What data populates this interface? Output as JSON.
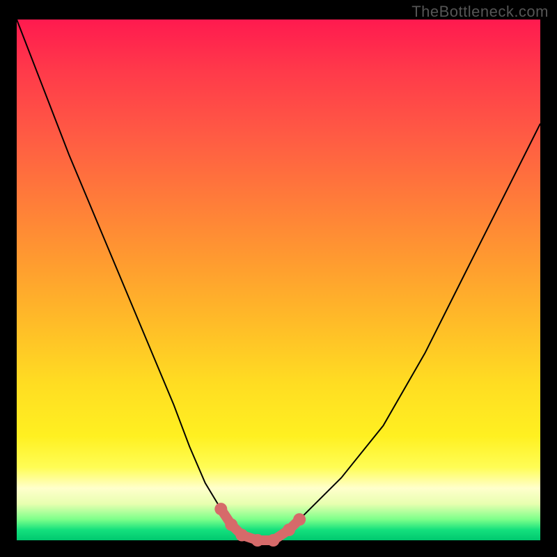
{
  "watermark": "TheBottleneck.com",
  "chart_data": {
    "type": "line",
    "title": "",
    "xlabel": "",
    "ylabel": "",
    "xlim": [
      0,
      100
    ],
    "ylim": [
      0,
      100
    ],
    "grid": false,
    "legend": false,
    "series": [
      {
        "name": "bottleneck-curve",
        "x": [
          0,
          5,
          10,
          15,
          20,
          25,
          30,
          33,
          36,
          39,
          42,
          45,
          48,
          52,
          56,
          62,
          70,
          78,
          86,
          94,
          100
        ],
        "y": [
          100,
          87,
          74,
          62,
          50,
          38,
          26,
          18,
          11,
          6,
          2,
          0,
          0,
          2,
          6,
          12,
          22,
          36,
          52,
          68,
          80
        ]
      }
    ],
    "markers": {
      "name": "highlight-region",
      "points": [
        {
          "x": 39,
          "y": 6
        },
        {
          "x": 41,
          "y": 3
        },
        {
          "x": 43,
          "y": 1
        },
        {
          "x": 46,
          "y": 0
        },
        {
          "x": 49,
          "y": 0
        },
        {
          "x": 52,
          "y": 2
        },
        {
          "x": 54,
          "y": 4
        }
      ]
    },
    "colors": {
      "gradient_top": "#ff1a4f",
      "gradient_mid": "#ffdd22",
      "gradient_bottom": "#00c86f",
      "curve": "#000000",
      "marker": "#d66a6a",
      "background": "#000000"
    }
  }
}
